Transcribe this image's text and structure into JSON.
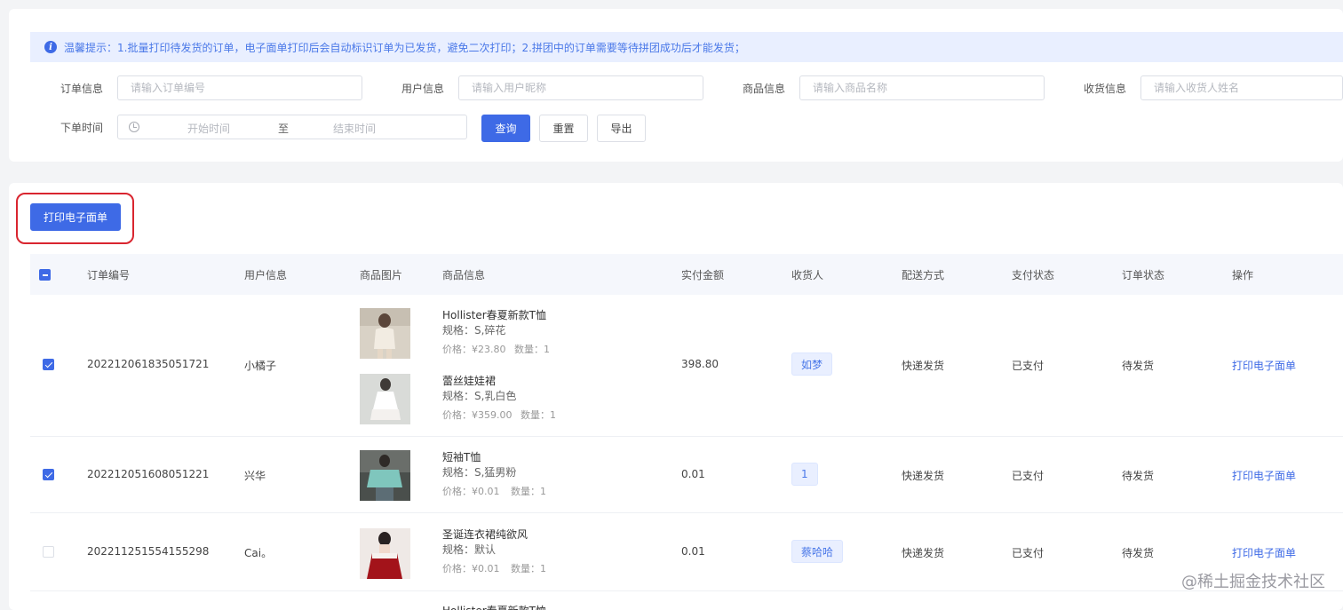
{
  "notice": {
    "text": "温馨提示：1.批量打印待发货的订单，电子面单打印后会自动标识订单为已发货，避免二次打印；2.拼团中的订单需要等待拼团成功后才能发货；"
  },
  "filters": {
    "order": {
      "label": "订单信息",
      "placeholder": "请输入订单编号"
    },
    "user": {
      "label": "用户信息",
      "placeholder": "请输入用户昵称"
    },
    "product": {
      "label": "商品信息",
      "placeholder": "请输入商品名称"
    },
    "receiver": {
      "label": "收货信息",
      "placeholder": "请输入收货人姓名"
    },
    "time": {
      "label": "下单时间",
      "start": "开始时间",
      "sep": "至",
      "end": "结束时间"
    },
    "buttons": {
      "query": "查询",
      "reset": "重置",
      "export": "导出"
    }
  },
  "toolbar": {
    "print_label": "打印电子面单"
  },
  "table": {
    "headers": [
      "订单编号",
      "用户信息",
      "商品图片",
      "商品信息",
      "实付金额",
      "收货人",
      "配送方式",
      "支付状态",
      "订单状态",
      "操作"
    ],
    "rows": [
      {
        "checked": true,
        "order_no": "202212061835051721",
        "user": "小橘子",
        "products": [
          {
            "title": "Hollister春夏新款T恤",
            "spec": "规格：S,碎花",
            "price": "价格：¥23.80",
            "qty": "数量：1"
          },
          {
            "title": "蕾丝娃娃裙",
            "spec": "规格：S,乳白色",
            "price": "价格：¥359.00",
            "qty": "数量：1"
          }
        ],
        "amount": "398.80",
        "receiver": "如梦",
        "delivery": "快递发货",
        "pay_status": "已支付",
        "order_status": "待发货",
        "action": "打印电子面单"
      },
      {
        "checked": true,
        "order_no": "202212051608051221",
        "user": "兴华",
        "products": [
          {
            "title": "短袖T恤",
            "spec": "规格：S,猛男粉",
            "price": "价格：¥0.01",
            "qty": "数量：1"
          }
        ],
        "amount": "0.01",
        "receiver": "1",
        "delivery": "快递发货",
        "pay_status": "已支付",
        "order_status": "待发货",
        "action": "打印电子面单"
      },
      {
        "checked": false,
        "order_no": "202211251554155298",
        "user": "Cai。",
        "products": [
          {
            "title": "圣诞连衣裙纯欲风",
            "spec": "规格：默认",
            "price": "价格：¥0.01",
            "qty": "数量：1"
          }
        ],
        "amount": "0.01",
        "receiver": "蔡哈哈",
        "delivery": "快递发货",
        "pay_status": "已支付",
        "order_status": "待发货",
        "action": "打印电子面单"
      },
      {
        "checked": false,
        "products": [
          {
            "title": "Hollister春夏新款T恤"
          }
        ]
      }
    ]
  },
  "watermark": "@稀土掘金技术社区",
  "colors": {
    "primary": "#3e6ae6",
    "notice_bg": "#e9efff",
    "highlight": "#d9252f"
  }
}
